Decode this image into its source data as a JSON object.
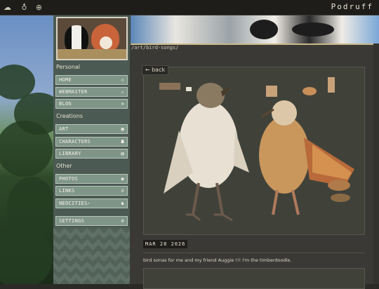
{
  "header": {
    "site_title": "Podruff",
    "icons": [
      "cloud-icon",
      "tooth-icon",
      "crosshair-icon"
    ]
  },
  "breadcrumb": "/art/bird-songs/",
  "back_label": "← back",
  "sidebar": {
    "sections": [
      {
        "title": "Personal",
        "items": [
          {
            "label": "HOME",
            "icon": "home-icon",
            "glyph": "⌂"
          },
          {
            "label": "WEBMASTER",
            "icon": "warning-icon",
            "glyph": "⚠"
          },
          {
            "label": "BLOG",
            "icon": "cog-icon",
            "glyph": "✲"
          }
        ]
      },
      {
        "title": "Creations",
        "items": [
          {
            "label": "ART",
            "icon": "image-icon",
            "glyph": "▣"
          },
          {
            "label": "CHARACTERS",
            "icon": "people-icon",
            "glyph": "☗"
          },
          {
            "label": "LIBRARY",
            "icon": "book-icon",
            "glyph": "▤"
          }
        ]
      },
      {
        "title": "Other",
        "items": [
          {
            "label": "PHOTOS",
            "icon": "camera-icon",
            "glyph": "◉"
          },
          {
            "label": "LINKS",
            "icon": "link-icon",
            "glyph": "∂"
          },
          {
            "label": "NEOCITIES",
            "icon": "cat-icon",
            "glyph": "♞",
            "external": "↗"
          }
        ]
      }
    ],
    "settings": {
      "label": "SETTINGS",
      "icon": "settings-icon",
      "glyph": "⚙"
    }
  },
  "post": {
    "date": "MAR 28 2026",
    "caption": "bird sonas for me and my friend Auggie !!! I'm the timberdoodle."
  }
}
